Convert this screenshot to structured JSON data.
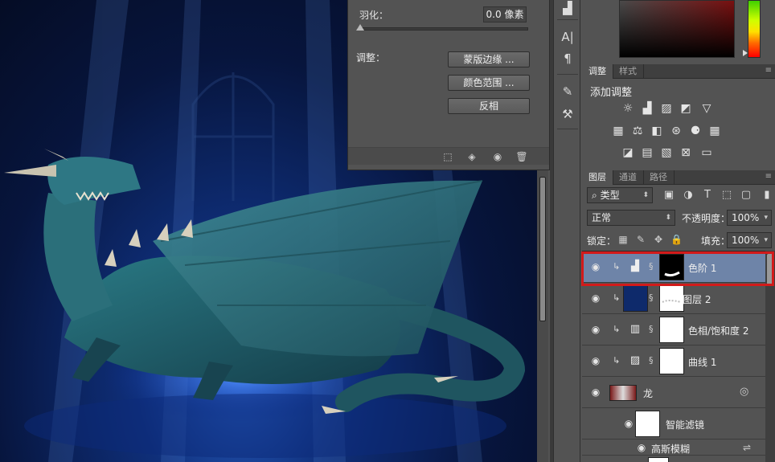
{
  "mask_properties": {
    "feather_label": "羽化：",
    "feather_value": "0.0 像素",
    "adjust_label": "调整：",
    "buttons": [
      "蒙版边缘 ...",
      "颜色范围 ...",
      "反相"
    ],
    "footer_icons": [
      "selection-icon",
      "apply-mask-icon",
      "visibility-icon",
      "trash-icon"
    ]
  },
  "tool_strip_icons": [
    "levels-icon",
    "character-icon",
    "paragraph-icon",
    "brushes-icon",
    "tool-presets-icon"
  ],
  "adjustments_panel": {
    "tabs": [
      "调整",
      "样式"
    ],
    "active_tab": "调整",
    "title": "添加调整",
    "icon_rows": [
      [
        "brightness-icon",
        "levels-icon",
        "curves-icon",
        "exposure-icon",
        "gradient-map-icon"
      ],
      [
        "vibrance-icon",
        "balance-icon",
        "black-white-icon",
        "photo-filter-icon",
        "channel-mixer-icon",
        "color-lookup-icon"
      ],
      [
        "invert-icon",
        "posterize-icon",
        "threshold-icon",
        "selective-color-icon",
        "gradient-icon"
      ]
    ]
  },
  "layers_panel": {
    "tabs": [
      "图层",
      "通道",
      "路径"
    ],
    "active_tab": "图层",
    "filter_kind": "类型",
    "blend_mode": "正常",
    "opacity_label": "不透明度：",
    "opacity_value": "100%",
    "lock_label": "锁定：",
    "fill_label": "填充：",
    "fill_value": "100%",
    "layers": [
      {
        "name": "色阶 1",
        "type": "levels",
        "selected": true
      },
      {
        "name": "图层 2",
        "type": "pixel",
        "selected": false
      },
      {
        "name": "色相/饱和度 2",
        "type": "hue-saturation",
        "selected": false
      },
      {
        "name": "曲线 1",
        "type": "curves",
        "selected": false
      },
      {
        "name": "龙",
        "type": "smart-object",
        "selected": false
      },
      {
        "name": "智能滤镜",
        "type": "smart-filters",
        "selected": false
      },
      {
        "name": "高斯模糊",
        "type": "filter",
        "selected": false
      }
    ]
  },
  "colors": {
    "selection_highlight": "#d21a1a",
    "selected_row": "#6e84a8",
    "panel_bg": "#535353"
  }
}
